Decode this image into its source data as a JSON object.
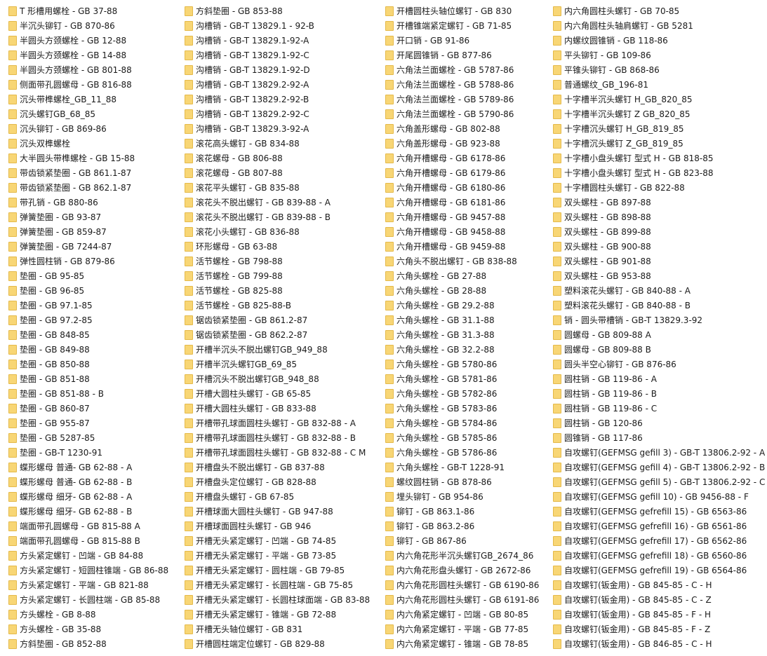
{
  "columns": [
    {
      "items": [
        "T 形槽用螺栓 - GB 37-88",
        "半沉头铆钉 - GB 870-86",
        "半圆头方颈螺栓 - GB 12-88",
        "半圆头方颈螺栓 - GB 14-88",
        "半圆头方颈螺栓 - GB 801-88",
        "侧面带孔圆螺母 - GB 816-88",
        "沉头带榫螺栓_GB_11_88",
        "沉头螺钉GB_68_85",
        "沉头铆钉 - GB 869-86",
        "沉头双榫螺栓",
        "大半圆头带榫螺栓 - GB 15-88",
        "带齿锁紧垫圈 - GB 861.1-87",
        "带齿锁紧垫圈 - GB 862.1-87",
        "带孔销 - GB 880-86",
        "弹簧垫圈 - GB 93-87",
        "弹簧垫圈 - GB 859-87",
        "弹簧垫圈 - GB 7244-87",
        "弹性圆柱销 - GB 879-86",
        "垫圈 - GB 95-85",
        "垫圈 - GB 96-85",
        "垫圈 - GB 97.1-85",
        "垫圈 - GB 97.2-85",
        "垫圈 - GB 848-85",
        "垫圈 - GB 849-88",
        "垫圈 - GB 850-88",
        "垫圈 - GB 851-88",
        "垫圈 - GB 851-88 - B",
        "垫圈 - GB 860-87",
        "垫圈 - GB 955-87",
        "垫圈 - GB 5287-85",
        "垫圈 - GB-T 1230-91",
        "蝶形螺母 普通- GB 62-88 - A",
        "蝶形螺母 普通- GB 62-88 - B",
        "蝶形螺母 细牙- GB 62-88 - A",
        "蝶形螺母 细牙- GB 62-88 - B",
        "端面带孔圆螺母 - GB 815-88 A",
        "端面带孔圆螺母 - GB 815-88 B",
        "方头紧定螺钉 - 凹端 - GB 84-88",
        "方头紧定螺钉 - 短圆柱锥端 - GB 86-88",
        "方头紧定螺钉 - 平端 - GB 821-88",
        "方头紧定螺钉 - 长圆柱端 - GB 85-88",
        "方头螺栓 - GB 8-88",
        "方头螺栓 - GB 35-88",
        "方斜垫圈 - GB 852-88"
      ]
    },
    {
      "items": [
        "方斜垫圈 - GB 853-88",
        "沟槽销 - GB-T 13829.1 - 92-B",
        "沟槽销 - GB-T 13829.1-92-A",
        "沟槽销 - GB-T 13829.1-92-C",
        "沟槽销 - GB-T 13829.1-92-D",
        "沟槽销 - GB-T 13829.2-92-A",
        "沟槽销 - GB-T 13829.2-92-B",
        "沟槽销 - GB-T 13829.2-92-C",
        "沟槽销 - GB-T 13829.3-92-A",
        "滚花高头螺钉 - GB 834-88",
        "滚花螺母 - GB 806-88",
        "滚花螺母 - GB 807-88",
        "滚花平头螺钉 - GB 835-88",
        "滚花头不脱出螺钉 - GB 839-88 - A",
        "滚花头不脱出螺钉 - GB 839-88 - B",
        "滚花小头螺钉 - GB 836-88",
        "环形螺母 - GB 63-88",
        "活节螺栓 - GB 798-88",
        "活节螺栓 - GB 799-88",
        "活节螺栓 - GB 825-88",
        "活节螺栓 - GB 825-88-B",
        "锯齿锁紧垫圈 - GB 861.2-87",
        "锯齿锁紧垫圈 - GB 862.2-87",
        "开槽半沉头不脱出螺钉GB_949_88",
        "开槽半沉头螺钉GB_69_85",
        "开槽沉头不脱出螺钉GB_948_88",
        "开槽大圆柱头螺钉 - GB 65-85",
        "开槽大圆柱头螺钉 - GB 833-88",
        "开槽带孔球面圆柱头螺钉 - GB 832-88 - A",
        "开槽带孔球面圆柱头螺钉 - GB 832-88 - B",
        "开槽带孔球面圆柱头螺钉 - GB 832-88 - C M",
        "开槽盘头不脱出螺钉 - GB 837-88",
        "开槽盘头定位螺钉 - GB 828-88",
        "开槽盘头螺钉 - GB 67-85",
        "开槽球面大圆柱头螺钉 - GB 947-88",
        "开槽球面圆柱头螺钉 - GB 946",
        "开槽无头紧定螺钉 - 凹端 - GB 74-85",
        "开槽无头紧定螺钉 - 平端 - GB 73-85",
        "开槽无头紧定螺钉 - 圆柱端 - GB 79-85",
        "开槽无头紧定螺钉 - 长圆柱端 - GB 75-85",
        "开槽无头紧定螺钉 - 长圆柱球面端 - GB 83-88",
        "开槽无头紧定螺钉 - 锥端 - GB 72-88",
        "开槽无头轴位螺钉 - GB 831",
        "开槽圆柱端定位螺钉 - GB 829-88"
      ]
    },
    {
      "items": [
        "开槽圆柱头轴位螺钉 - GB 830",
        "开槽锥端紧定螺钉 - GB 71-85",
        "开口销 - GB 91-86",
        "开尾圆锥销 - GB 877-86",
        "六角法兰面螺栓 - GB 5787-86",
        "六角法兰面螺栓 - GB 5788-86",
        "六角法兰面螺栓 - GB 5789-86",
        "六角法兰面螺栓 - GB 5790-86",
        "六角盖形螺母 - GB 802-88",
        "六角盖形螺母 - GB 923-88",
        "六角开槽螺母 - GB 6178-86",
        "六角开槽螺母 - GB 6179-86",
        "六角开槽螺母 - GB 6180-86",
        "六角开槽螺母 - GB 6181-86",
        "六角开槽螺母 - GB 9457-88",
        "六角开槽螺母 - GB 9458-88",
        "六角开槽螺母 - GB 9459-88",
        "六角头不脱出螺钉 - GB 838-88",
        "六角头螺栓 - GB 27-88",
        "六角头螺栓 - GB 28-88",
        "六角头螺栓 - GB 29.2-88",
        "六角头螺栓 - GB 31.1-88",
        "六角头螺栓 - GB 31.3-88",
        "六角头螺栓 - GB 32.2-88",
        "六角头螺栓 - GB 5780-86",
        "六角头螺栓 - GB 5781-86",
        "六角头螺栓 - GB 5782-86",
        "六角头螺栓 - GB 5783-86",
        "六角头螺栓 - GB 5784-86",
        "六角头螺栓 - GB 5785-86",
        "六角头螺栓 - GB 5786-86",
        "六角头螺栓 - GB-T 1228-91",
        "螺纹圆柱销 - GB 878-86",
        "埋头铆钉 - GB 954-86",
        "铆钉 - GB 863.1-86",
        "铆钉 - GB 863.2-86",
        "铆钉 - GB 867-86",
        "内六角花形半沉头螺钉GB_2674_86",
        "内六角花形盘头螺钉 - GB 2672-86",
        "内六角花形圆柱头螺钉 - GB 6190-86",
        "内六角花形圆柱头螺钉 - GB 6191-86",
        "内六角紧定螺钉 - 凹端 - GB 80-85",
        "内六角紧定螺钉 - 平端 - GB 77-85",
        "内六角紧定螺钉 - 锥端 - GB 78-85"
      ]
    },
    {
      "items": [
        "内六角圆柱头螺钉 - GB 70-85",
        "内六角圆柱头轴肩螺钉 - GB 5281",
        "内螺纹圆锥销 - GB 118-86",
        "平头铆钉 - GB 109-86",
        "平锥头铆钉 - GB 868-86",
        "普通螺纹_GB_196-81",
        "十字槽半沉头螺钉 H_GB_820_85",
        "十字槽半沉头螺钉 Z GB_820_85",
        "十字槽沉头螺钉 H_GB_819_85",
        "十字槽沉头螺钉 Z_GB_819_85",
        "十字槽小盘头螺钉 型式 H - GB 818-85",
        "十字槽小盘头螺钉 型式 H - GB 823-88",
        "十字槽圆柱头螺钉 - GB 822-88",
        "双头螺柱 - GB 897-88",
        "双头螺柱 - GB 898-88",
        "双头螺柱 - GB 899-88",
        "双头螺柱 - GB 900-88",
        "双头螺柱 - GB 901-88",
        "双头螺柱 - GB 953-88",
        "塑料滚花头螺钉 - GB 840-88 - A",
        "塑料滚花头螺钉 - GB 840-88 - B",
        "销 - 圆头带槽销 - GB-T 13829.3-92",
        "圆螺母 - GB 809-88 A",
        "圆螺母 - GB 809-88 B",
        "圆头半空心铆钉 - GB 876-86",
        "圆柱销 - GB 119-86 - A",
        "圆柱销 - GB 119-86 - B",
        "圆柱销 - GB 119-86 - C",
        "圆柱销 - GB 120-86",
        "圆锥销 - GB 117-86",
        "自攻螺钉(GEFMSG gefill 3) - GB-T 13806.2-92 - A",
        "自攻螺钉(GEFMSG gefill 4) - GB-T 13806.2-92 - B",
        "自攻螺钉(GEFMSG gefill 5) - GB-T 13806.2-92 - C",
        "自攻螺钉(GEFMSG gefill 10) - GB 9456-88 - F",
        "自攻螺钉(GEFMSG gefrefill 15) - GB 6563-86",
        "自攻螺钉(GEFMSG gefrefill 16) - GB 6561-86",
        "自攻螺钉(GEFMSG gefrefill 17) - GB 6562-86",
        "自攻螺钉(GEFMSG gefrefill 18) - GB 6560-86",
        "自攻螺钉(GEFMSG gefrefill 19) - GB 6564-86",
        "自攻螺钉(钣金用) - GB 845-85 - C - H",
        "自攻螺钉(钣金用) - GB 845-85 - C - Z",
        "自攻螺钉(钣金用) - GB 845-85 - F - H",
        "自攻螺钉(钣金用) - GB 845-85 - F - Z",
        "自攻螺钉(钣金用) - GB 846-85 - C - H"
      ]
    }
  ],
  "folder_color": "#f8d675"
}
